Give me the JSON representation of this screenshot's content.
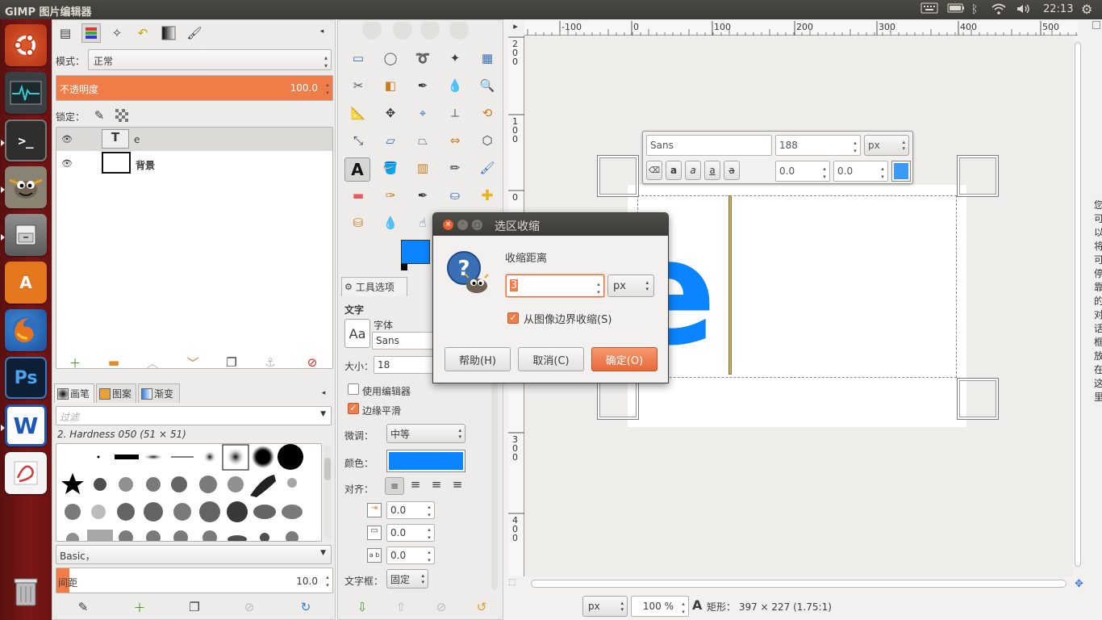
{
  "window": {
    "title": "GIMP 图片编辑器"
  },
  "topbar": {
    "clock": "22:13",
    "keyboard_icon": "keyboard-icon",
    "battery_icon": "battery-icon",
    "bluetooth_icon": "bluetooth-icon",
    "wifi_icon": "wifi-icon",
    "volume_icon": "volume-icon",
    "settings_icon": "gear-icon"
  },
  "launcher": {
    "items": [
      "ubuntu-dash",
      "system-monitor",
      "terminal",
      "gimp",
      "file-manager",
      "software-center",
      "firefox",
      "photoshop",
      "wps-writer",
      "document-viewer",
      "trash"
    ],
    "ps_label": "Ps",
    "w_label": "W",
    "store_label": "A"
  },
  "layers": {
    "mode_label": "模式：",
    "mode_value": "正常",
    "opacity_label": "不透明度",
    "opacity_value": "100.0",
    "opacity_fraction": 1.0,
    "lock_label": "锁定：",
    "items": [
      {
        "name": "e",
        "thumb": "T"
      },
      {
        "name": "背景"
      }
    ]
  },
  "brushes": {
    "tabs": [
      "画笔",
      "图案",
      "渐变"
    ],
    "filter_placeholder": "过滤",
    "selected": "2. Hardness 050 (51 × 51)",
    "preset": "Basic，",
    "spacing_label": "间距",
    "spacing_value": "10.0",
    "spacing_fraction": 0.1
  },
  "toolopts": {
    "title": "工具选项",
    "section": "文字",
    "font_label": "字体",
    "font_value": "Sans",
    "font_preview": "Aa",
    "size_label": "大小：",
    "size_value": "18",
    "use_editor_label": "使用编辑器",
    "use_editor_checked": false,
    "antialias_label": "边缘平滑",
    "antialias_checked": true,
    "hinting_label": "微调：",
    "hinting_value": "中等",
    "color_label": "颜色：",
    "color": "#0a84ff",
    "justify_label": "对齐：",
    "indent_value": "0.0",
    "linespacing_value": "0.0",
    "letterspacing_value": "0.0",
    "box_label": "文字框：",
    "box_value": "固定"
  },
  "text_toolbar": {
    "font": "Sans",
    "size": "188",
    "unit": "px",
    "baseline": "0.0",
    "kerning": "0.0",
    "color": "#3d99f6"
  },
  "rulers": {
    "h_ticks": [
      "-100",
      "0",
      "100",
      "200",
      "300",
      "400",
      "500"
    ],
    "v_ticks": [
      "200",
      "100",
      "0",
      "300",
      "400"
    ]
  },
  "canvas": {
    "text_glyph": "e",
    "text_color": "#0a84ff"
  },
  "dialog": {
    "title": "选区收缩",
    "label": "收缩距离",
    "value": "3",
    "unit": "px",
    "checkbox_label": "从图像边界收缩(S)",
    "checkbox_checked": true,
    "help": "帮助(H)",
    "cancel": "取消(C)",
    "ok": "确定(O)"
  },
  "statusbar": {
    "unit": "px",
    "zoom": "100 %",
    "message": "矩形： 397 × 227  (1.75:1)"
  },
  "side_hint": "您可以将可停靠的对话框放在这里"
}
